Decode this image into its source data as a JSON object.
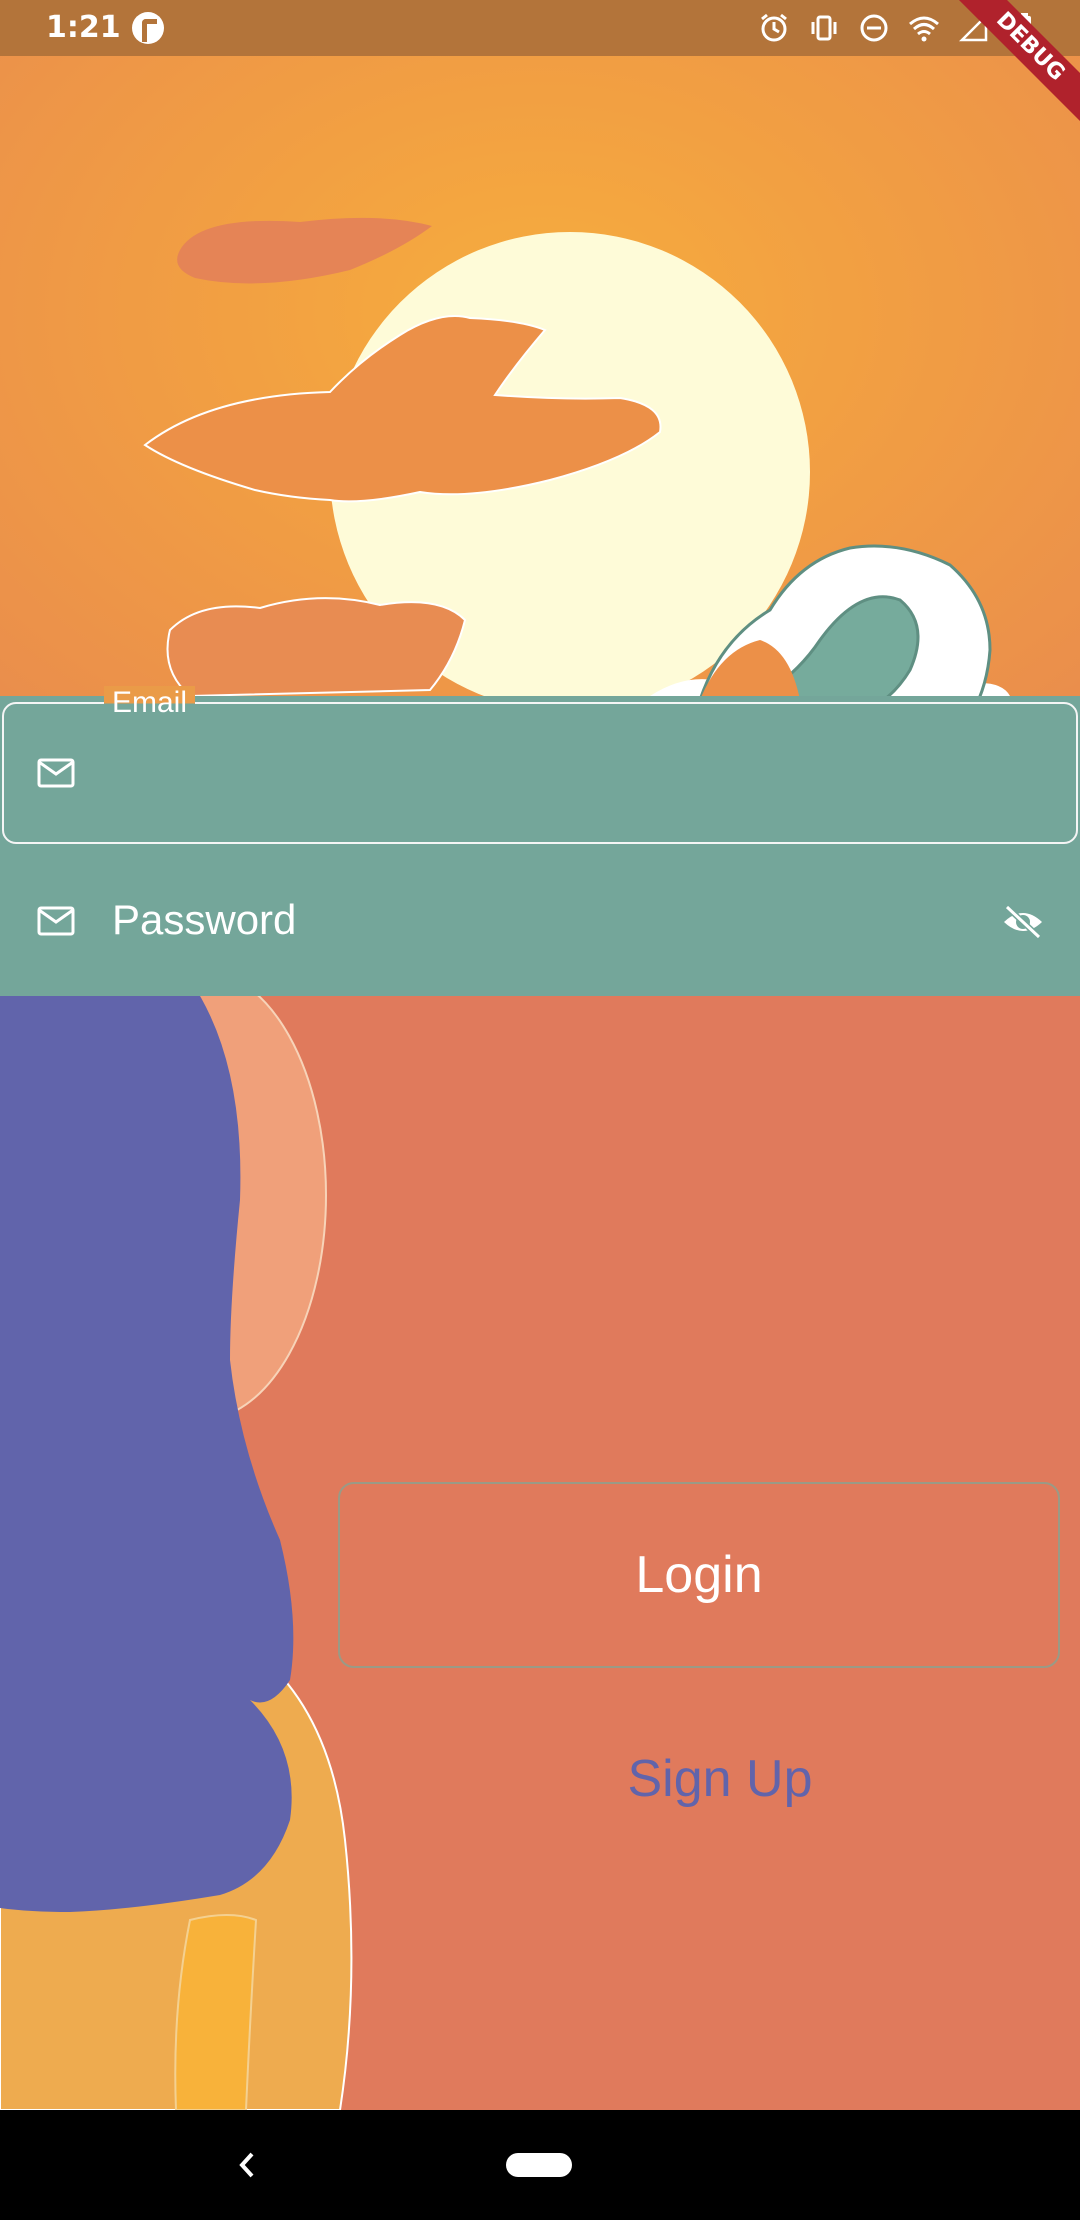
{
  "status_bar": {
    "time": "1:21",
    "icons": [
      "app-notification-icon",
      "alarm-icon",
      "vibrate-icon",
      "do-not-disturb-icon",
      "wifi-icon",
      "signal-icon",
      "battery-icon"
    ]
  },
  "debug_banner": "DEBUG",
  "form": {
    "email": {
      "label": "Email",
      "value": "",
      "icon": "mail-icon"
    },
    "password": {
      "placeholder": "Password",
      "icon": "mail-icon",
      "visibility_icon": "eye-off-icon"
    }
  },
  "actions": {
    "login_label": "Login",
    "signup_label": "Sign Up"
  },
  "colors": {
    "sky": "#f2a042",
    "sun": "#fefbd8",
    "sea": "#76ab9c",
    "ground": "#e07a5c",
    "person_hair": "#6164ab",
    "signup_text": "#6164ab",
    "debug_banner": "#b0222c"
  },
  "nav_bar": {
    "icons": [
      "back-icon",
      "home-pill"
    ]
  }
}
